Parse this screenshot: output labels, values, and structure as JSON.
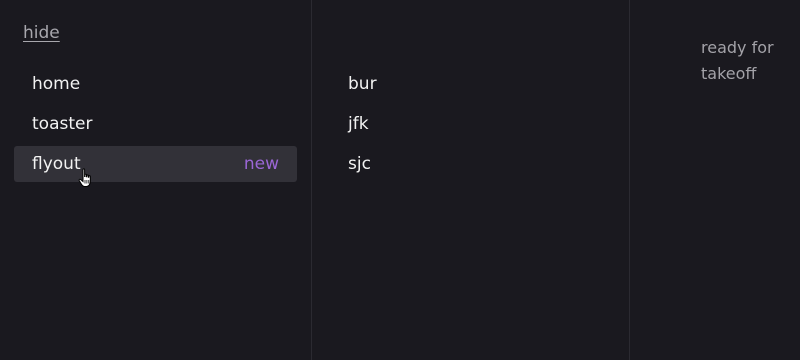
{
  "sidebar": {
    "hide_label": "hide",
    "items": [
      {
        "label": "home",
        "badge": ""
      },
      {
        "label": "toaster",
        "badge": ""
      },
      {
        "label": "flyout",
        "badge": "new"
      }
    ]
  },
  "airports": {
    "items": [
      "bur",
      "jfk",
      "sjc"
    ]
  },
  "status": {
    "text": "ready for takeoff"
  },
  "colors": {
    "background": "#1a191f",
    "active_item": "#323138",
    "badge": "#9b66d6",
    "divider": "#2b2a31"
  },
  "icons": {
    "cursor": "hand-pointer-icon"
  }
}
